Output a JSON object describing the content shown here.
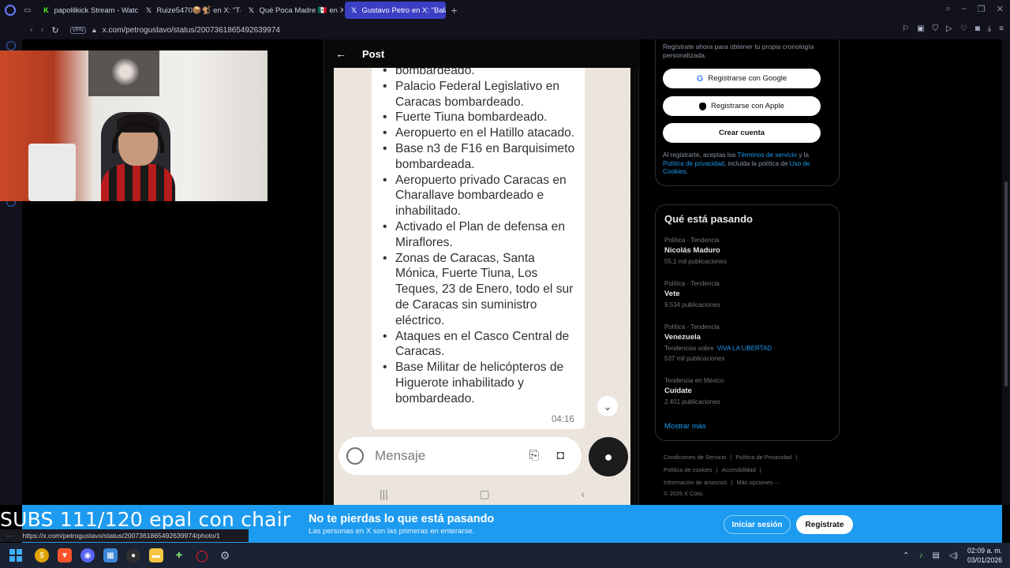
{
  "browser": {
    "tabs": [
      {
        "label": "papolilkick Stream - Watc",
        "icon": "kick-icon",
        "color": "#53fc18",
        "active": false
      },
      {
        "label": "Ruize5470📦🐒 en X: \"T(",
        "icon": "x-icon",
        "color": "#ffffff",
        "active": false
      },
      {
        "label": "Qué Poca Madre 🇲🇽 en X:",
        "icon": "x-icon",
        "color": "#ffffff",
        "active": false
      },
      {
        "label": "Gustavo Petro en X: \"Bala",
        "icon": "x-icon",
        "color": "#ffffff",
        "active": true
      }
    ],
    "vpn_label": "VPN",
    "url": "x.com/petrogustavo/status/2007361865492639974",
    "status_url": "https://x.com/petrogustavo/status/2007361865492639974/photo/1"
  },
  "modal": {
    "title": "Post",
    "chat_items": [
      "bombardeado.",
      "Palacio Federal Legislativo en Caracas bombardeado.",
      "Fuerte Tiuna bombardeado.",
      "Aeropuerto en el Hatillo atacado.",
      "Base n3 de F16 en Barquisimeto bombardeada.",
      "Aeropuerto privado Caracas en Charallave bombardeado e inhabilitado.",
      "Activado el Plan de defensa en Miraflores.",
      "Zonas de Caracas, Santa Mónica, Fuerte Tiuna, Los Teques, 23 de Enero, todo el sur de Caracas sin suministro eléctrico.",
      "Ataques en el Casco Central de Caracas.",
      "Base Militar de helicópteros de Higuerote inhabilitado y bombardeado."
    ],
    "chat_time": "04:16",
    "input_placeholder": "Mensaje"
  },
  "signup": {
    "intro": "Regístrate ahora para obtener tu propia cronología personalizada.",
    "google_label": "Registrarse con Google",
    "apple_label": "Registrarse con Apple",
    "create_label": "Crear cuenta",
    "legal_1": "Al registrarte, aceptas los ",
    "legal_terms": "Términos de servicio",
    "legal_2": " y la ",
    "legal_privacy": "Política de privacidad",
    "legal_3": ", incluida la política de ",
    "legal_cookies": "Uso de Cookies",
    "legal_4": "."
  },
  "trends": {
    "title": "Qué está pasando",
    "items": [
      {
        "category": "Política · Tendencia",
        "name": "Nicolás Maduro",
        "posts": "55,1 mil publicaciones"
      },
      {
        "category": "Política · Tendencia",
        "name": "Vete",
        "posts": "9.534 publicaciones"
      },
      {
        "category": "Política · Tendencia",
        "name": "Venezuela",
        "related_prefix": "Tendencias sobre",
        "related_link": "VIVA LA LIBERTAD",
        "posts": "537 mil publicaciones"
      },
      {
        "category": "Tendencia en México",
        "name": "Cuídate",
        "posts": "2.401 publicaciones"
      }
    ],
    "show_more": "Mostrar más"
  },
  "footer": {
    "links": [
      "Condiciones de Servicio",
      "Política de Privacidad",
      "Política de cookies",
      "Accesibilidad",
      "Información de anuncios",
      "Más opciones ···"
    ],
    "copyright": "© 2026 X Corp."
  },
  "banner": {
    "title": "No te pierdas lo que está pasando",
    "subtitle": "Las personas en X son las primeras en enterarse.",
    "login": "Iniciar sesión",
    "register": "Regístrate",
    "color": "#1d9bf0"
  },
  "overlay": {
    "text": "SUBS 111/120 epal con chair"
  },
  "taskbar": {
    "time": "02:09 a. m.",
    "date": "03/01/2026"
  }
}
